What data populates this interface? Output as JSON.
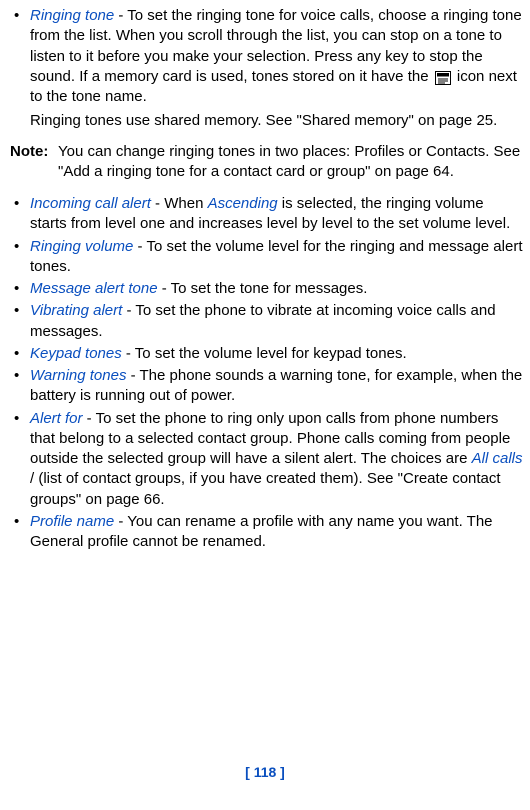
{
  "items_a": [
    {
      "term": "Ringing tone",
      "body": " - To set the ringing tone for voice calls, choose a ringing tone from the list. When you scroll through the list, you can stop on a tone to listen to it before you make your selection. Press any key to stop the sound. If a memory card is used, tones stored on it have the ",
      "after_icon": " icon next to the tone name."
    }
  ],
  "shared_memory": "Ringing tones use shared memory.  See \"Shared memory\" on page 25.",
  "note": {
    "label": "Note:",
    "body": "You can change ringing tones in two places: Profiles or Contacts. See \"Add a ringing tone for a contact card or group\" on page 64."
  },
  "items_b": [
    {
      "term": "Incoming call alert",
      "pre": " - When ",
      "inline_term": "Ascending",
      "post": " is selected, the ringing volume starts from level one and increases level by level to the set volume level."
    },
    {
      "term": "Ringing volume",
      "body": " - To set the volume level for the ringing and message alert tones."
    },
    {
      "term": "Message alert tone",
      "body": " - To set the tone for messages."
    },
    {
      "term": "Vibrating alert",
      "body": " - To set the phone to vibrate at incoming voice calls and messages."
    },
    {
      "term": "Keypad tones",
      "body": " - To set the volume level for keypad tones."
    },
    {
      "term": "Warning tones",
      "body": " - The phone sounds a warning tone, for example, when the battery is running out of power."
    },
    {
      "term": "Alert for",
      "pre": " - To set the phone to ring only upon calls from phone numbers that belong to a selected contact group. Phone calls coming from people outside the selected group will have a silent alert. The choices are ",
      "inline_term": "All calls",
      "post": " / (list of contact groups, if you have created them). See \"Create contact groups\" on page 66."
    },
    {
      "term": "Profile name",
      "body": " - You can rename a profile with any name you want. The General profile cannot be renamed."
    }
  ],
  "page_number": "[ 118 ]"
}
